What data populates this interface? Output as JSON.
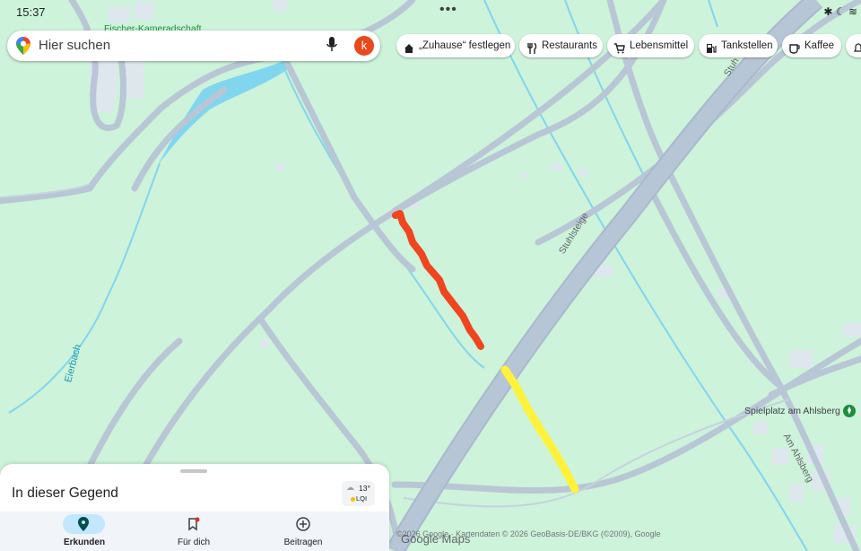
{
  "status_bar": {
    "time": "15:37",
    "dots": "•••"
  },
  "search": {
    "placeholder": "Hier suchen",
    "avatar_letter": "k"
  },
  "chips": [
    {
      "label": "„Zuhause“ festlegen",
      "icon": "home-icon"
    },
    {
      "label": "Restaurants",
      "icon": "fork-knife-icon"
    },
    {
      "label": "Lebensmittel",
      "icon": "cart-icon"
    },
    {
      "label": "Tankstellen",
      "icon": "fuel-icon"
    },
    {
      "label": "Kaffee",
      "icon": "coffee-icon"
    }
  ],
  "map": {
    "labels": {
      "fischer": "Fischer-Kameradschaft",
      "stuhlsteige": "Stuhlsteige",
      "stuhlsteige_top": "Stuh",
      "eierbach": "Eierbach",
      "am_ahlsberg": "Am Ahlsberg",
      "spielplatz": "Spielplatz am Ahlsberg"
    },
    "colors": {
      "land": "#cdf3da",
      "road": "#b9c6d6",
      "highway": "#a9b9cc",
      "water": "#80d6ee",
      "red_route": "#f0451e",
      "yellow_route": "#fff23a"
    }
  },
  "sheet": {
    "title": "In dieser Gegend",
    "temperature": "13°",
    "aqi": "LQI"
  },
  "nav": {
    "items": [
      "Erkunden",
      "Für dich",
      "Beitragen"
    ]
  },
  "credits": "©2026 Google · Kartendaten © 2026 GeoBasis-DE/BKG (©2009), Google",
  "google_maps": "Google Maps"
}
